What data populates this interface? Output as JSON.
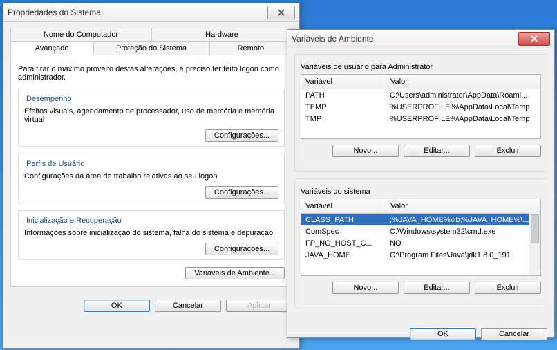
{
  "sysprops": {
    "title": "Propriedades do Sistema",
    "tabs_row1": [
      "Nome do Computador",
      "Hardware"
    ],
    "tabs_row2": [
      "Avançado",
      "Proteção do Sistema",
      "Remoto"
    ],
    "intro": "Para tirar o máximo proveito destas alterações, é preciso ter feito logon como administrador.",
    "perf": {
      "title": "Desempenho",
      "desc": "Efeitos visuais, agendamento de processador, uso de memória e memória virtual",
      "button": "Configurações..."
    },
    "profiles": {
      "title": "Perfis de Usuário",
      "desc": "Configurações da área de trabalho relativas ao seu logon",
      "button": "Configurações..."
    },
    "startup": {
      "title": "Inicialização e Recuperação",
      "desc": "Informações sobre inicialização do sistema, falha do sistema e depuração",
      "button": "Configurações..."
    },
    "envbtn": "Variáveis de Ambiente...",
    "ok": "OK",
    "cancel": "Cancelar",
    "apply": "Aplicar"
  },
  "envdlg": {
    "title": "Variáveis de Ambiente",
    "user_section": "Variáveis de usuário para Administrator",
    "sys_section": "Variáveis do sistema",
    "col_var": "Variável",
    "col_val": "Valor",
    "user_rows": [
      {
        "n": "PATH",
        "v": "C:\\Users\\administrator\\AppData\\Roami..."
      },
      {
        "n": "TEMP",
        "v": "%USERPROFILE%\\AppData\\Local\\Temp"
      },
      {
        "n": "TMP",
        "v": "%USERPROFILE%\\AppData\\Local\\Temp"
      }
    ],
    "sys_rows": [
      {
        "n": "CLASS_PATH",
        "v": ";%JAVA_HOME%\\lib;%JAVA_HOME%\\...",
        "selected": true
      },
      {
        "n": "ComSpec",
        "v": "C:\\Windows\\system32\\cmd.exe"
      },
      {
        "n": "FP_NO_HOST_C...",
        "v": "NO"
      },
      {
        "n": "JAVA_HOME",
        "v": "C:\\Program Files\\Java\\jdk1.8.0_191"
      }
    ],
    "new": "Novo...",
    "edit": "Editar...",
    "del": "Excluir",
    "ok": "OK",
    "cancel": "Cancelar"
  }
}
